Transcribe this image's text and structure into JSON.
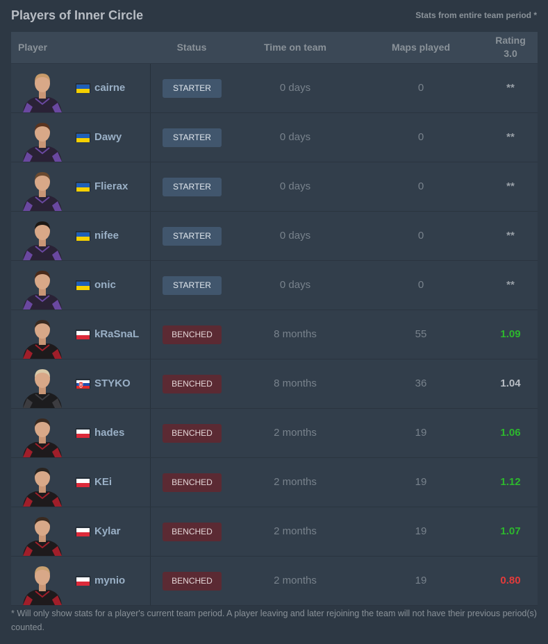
{
  "header": {
    "title": "Players of Inner Circle",
    "stats_note": "Stats from entire team period *"
  },
  "columns": {
    "player": "Player",
    "status": "Status",
    "time": "Time on team",
    "maps": "Maps played",
    "rating_line1": "Rating",
    "rating_line2": "3.0"
  },
  "colors": {
    "rating_good": "#2db82d",
    "rating_neutral": "#b8bdc4",
    "rating_bad": "#e33b3b",
    "rating_hidden": "#9aa1a8",
    "jersey_purple": "#3a2a55",
    "jersey_red": "#a01e2a"
  },
  "players": [
    {
      "nick": "cairne",
      "flag": "ukraine",
      "status": "STARTER",
      "time": "0 days",
      "maps": "0",
      "rating": "**",
      "rating_tone": "hidden",
      "jersey": "purple",
      "hair": "#c79a6a"
    },
    {
      "nick": "Dawy",
      "flag": "ukraine",
      "status": "STARTER",
      "time": "0 days",
      "maps": "0",
      "rating": "**",
      "rating_tone": "hidden",
      "jersey": "purple",
      "hair": "#5a3420"
    },
    {
      "nick": "Flierax",
      "flag": "ukraine",
      "status": "STARTER",
      "time": "0 days",
      "maps": "0",
      "rating": "**",
      "rating_tone": "hidden",
      "jersey": "purple",
      "hair": "#6b4a30"
    },
    {
      "nick": "nifee",
      "flag": "ukraine",
      "status": "STARTER",
      "time": "0 days",
      "maps": "0",
      "rating": "**",
      "rating_tone": "hidden",
      "jersey": "purple",
      "hair": "#1d1814"
    },
    {
      "nick": "onic",
      "flag": "ukraine",
      "status": "STARTER",
      "time": "0 days",
      "maps": "0",
      "rating": "**",
      "rating_tone": "hidden",
      "jersey": "purple",
      "hair": "#4a2a1a"
    },
    {
      "nick": "kRaSnaL",
      "flag": "poland",
      "status": "BENCHED",
      "time": "8 months",
      "maps": "55",
      "rating": "1.09",
      "rating_tone": "good",
      "jersey": "red",
      "hair": "#3a2a20"
    },
    {
      "nick": "STYKO",
      "flag": "slovakia",
      "status": "BENCHED",
      "time": "8 months",
      "maps": "36",
      "rating": "1.04",
      "rating_tone": "neutral",
      "jersey": "black",
      "hair": "#d8c9a8"
    },
    {
      "nick": "hades",
      "flag": "poland",
      "status": "BENCHED",
      "time": "2 months",
      "maps": "19",
      "rating": "1.06",
      "rating_tone": "good",
      "jersey": "red",
      "hair": "#3a2a20"
    },
    {
      "nick": "KEi",
      "flag": "poland",
      "status": "BENCHED",
      "time": "2 months",
      "maps": "19",
      "rating": "1.12",
      "rating_tone": "good",
      "jersey": "red",
      "hair": "#2a2420"
    },
    {
      "nick": "Kylar",
      "flag": "poland",
      "status": "BENCHED",
      "time": "2 months",
      "maps": "19",
      "rating": "1.07",
      "rating_tone": "good",
      "jersey": "red",
      "hair": "#3a2a20"
    },
    {
      "nick": "mynio",
      "flag": "poland",
      "status": "BENCHED",
      "time": "2 months",
      "maps": "19",
      "rating": "0.80",
      "rating_tone": "bad",
      "jersey": "red",
      "hair": "#c9a070"
    }
  ],
  "footnote": "* Will only show stats for a player's current team period. A player leaving and later rejoining the team will not have their previous period(s) counted."
}
